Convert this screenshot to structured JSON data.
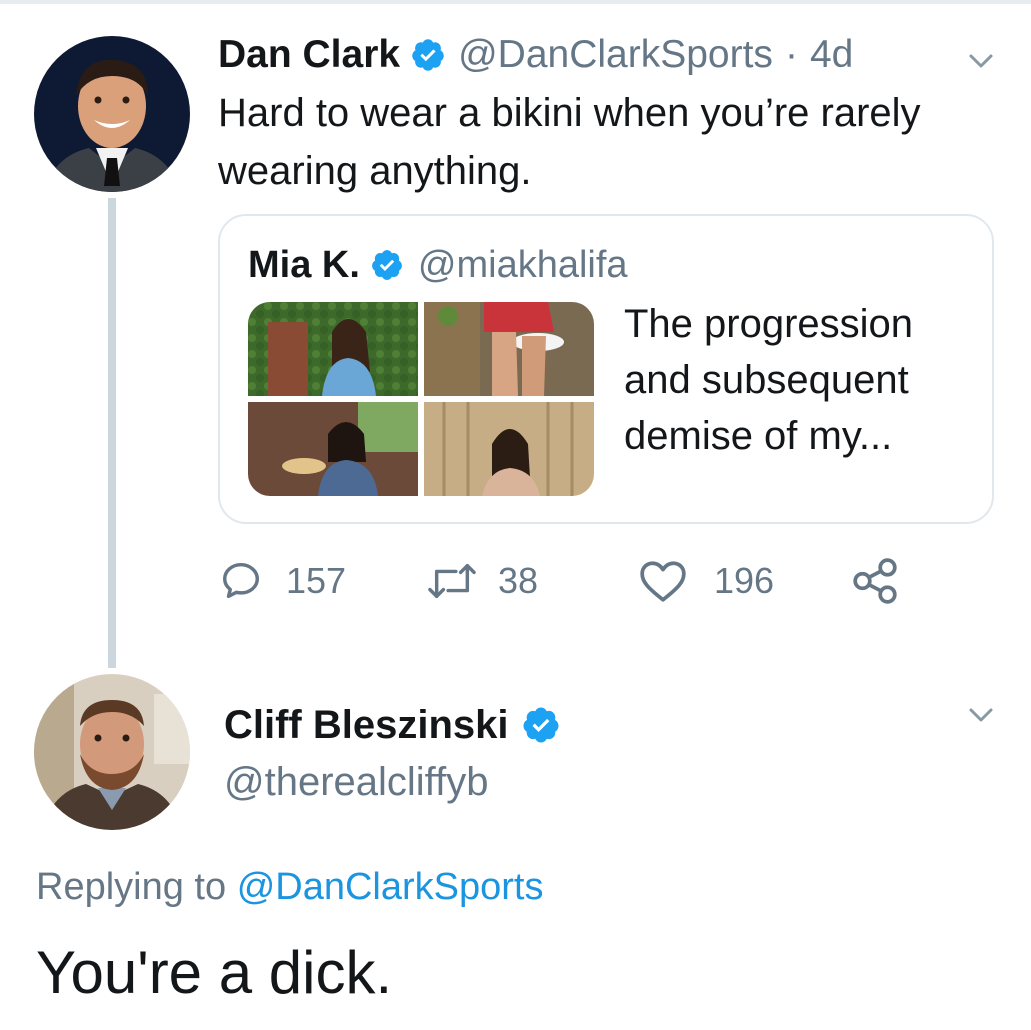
{
  "colors": {
    "text": "#14171a",
    "secondary": "#657786",
    "link": "#1b95e0",
    "verified": "#1da1f2",
    "border": "#e1e8ed",
    "thread_line": "#ccd6dd"
  },
  "main_tweet": {
    "author_name": "Dan Clark",
    "author_handle": "@DanClarkSports",
    "separator": "·",
    "time": "4d",
    "text": "Hard to wear a bikini when you’re rarely wearing anything.",
    "avatar_icon": "avatar-man-suit",
    "menu_icon": "chevron-down-icon",
    "quote": {
      "author_name": "Mia K.",
      "author_handle": "@miakhalifa",
      "text": "The progression and subsequent demise of my...",
      "media_count": 4
    },
    "actions": {
      "replies": "157",
      "retweets": "38",
      "likes": "196"
    }
  },
  "reply_tweet": {
    "author_name": "Cliff Bleszinski",
    "author_handle": "@therealcliffyb",
    "avatar_icon": "avatar-man-beard",
    "menu_icon": "chevron-down-icon",
    "replying_prefix": "Replying to",
    "replying_to": "@DanClarkSports",
    "text": "You're a dick."
  }
}
